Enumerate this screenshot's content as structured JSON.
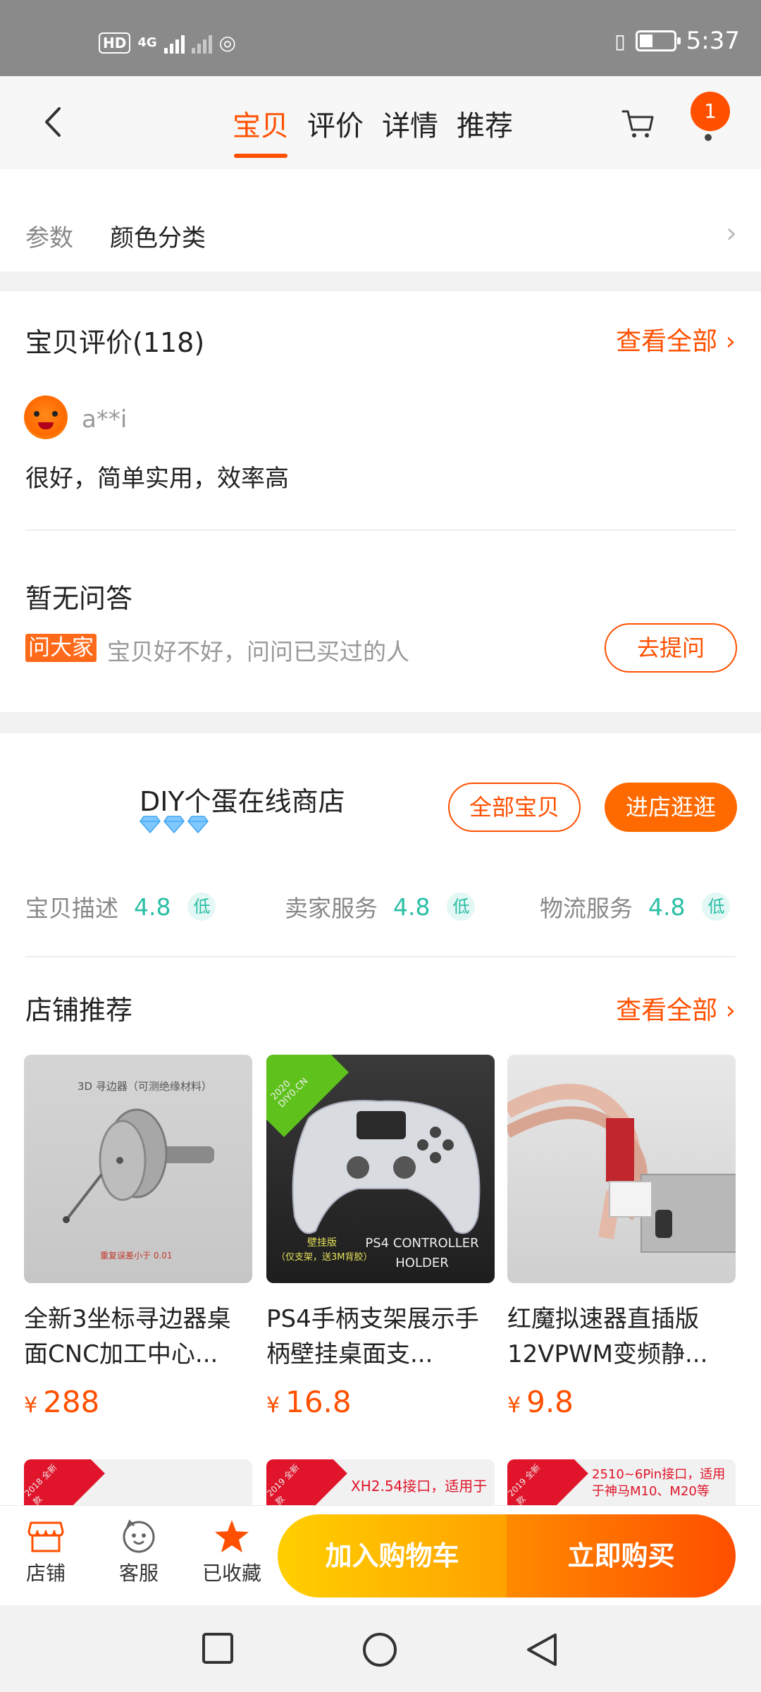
{
  "status_bar": {
    "hd": "HD",
    "sim": "1",
    "net": "4G",
    "hotspot": "1",
    "time": "5:37"
  },
  "header": {
    "tabs": [
      {
        "label": "宝贝"
      },
      {
        "label": "评价"
      },
      {
        "label": "详情"
      },
      {
        "label": "推荐"
      }
    ],
    "cart_badge": "1"
  },
  "params": {
    "label": "参数",
    "value": "颜色分类"
  },
  "reviews": {
    "title": "宝贝评价(118)",
    "view_all": "查看全部",
    "user": "a**i",
    "text": "很好，简单实用，效率高"
  },
  "qa": {
    "title": "暂无问答",
    "tag": "问大家",
    "hint": "宝贝好不好，问问已买过的人",
    "ask_button": "去提问"
  },
  "shop": {
    "name": "DIY个蛋在线商店",
    "all_button": "全部宝贝",
    "visit_button": "进店逛逛",
    "ratings": [
      {
        "label": "宝贝描述",
        "score": "4.8",
        "level": "低"
      },
      {
        "label": "卖家服务",
        "score": "4.8",
        "level": "低"
      },
      {
        "label": "物流服务",
        "score": "4.8",
        "level": "低"
      }
    ],
    "recommend_title": "店铺推荐",
    "recommend_all": "查看全部"
  },
  "products": [
    {
      "name": "全新3坐标寻边器桌面CNC加工中心...",
      "currency": "¥",
      "price": "288",
      "img_caption": "3D 寻边器（可测绝缘材料）",
      "img_caption2": "重复误差小于 0.01"
    },
    {
      "name": "PS4手柄支架展示手柄壁挂桌面支...",
      "currency": "¥",
      "price": "16.8",
      "img_corner": "2020 DIY0.CN",
      "img_caption": "壁挂版",
      "img_caption2": "（仅支架，送3M背胶）",
      "img_caption3": "PS4 CONTROLLER HOLDER"
    },
    {
      "name": "红魔拟速器直插版12VPWM变频静...",
      "currency": "¥",
      "price": "9.8"
    }
  ],
  "next_products": [
    {
      "corner": "2018 全新款",
      "text": ""
    },
    {
      "corner": "2019 全新款",
      "text": "XH2.54接口，适用于"
    },
    {
      "corner": "2019 全新款",
      "text": "2510~6Pin接口，适用于神马M10、M20等"
    }
  ],
  "actionbar": {
    "shop": "店铺",
    "service": "客服",
    "favorite": "已收藏",
    "add_cart": "加入购物车",
    "buy_now": "立即购买"
  },
  "colors": {
    "accent": "#ff5000",
    "rating": "#2bbfa6"
  }
}
